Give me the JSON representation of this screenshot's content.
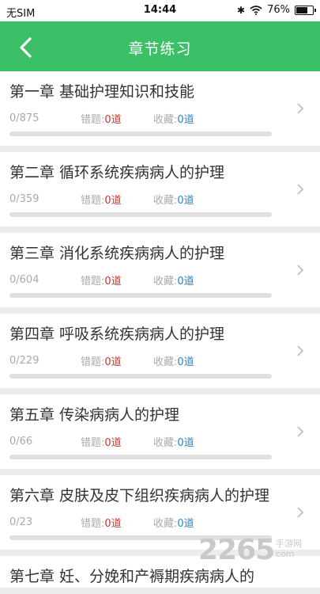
{
  "status_bar": {
    "carrier": "无SIM",
    "time": "14:44",
    "bluetooth": "✱",
    "battery_percent": "76%",
    "battery_level": 0.76
  },
  "header": {
    "title": "章节练习",
    "back_icon": "chevron-left-icon"
  },
  "colors": {
    "accent": "#3bbf67",
    "wrong": "#c0392b",
    "favorite": "#2e86c1"
  },
  "labels": {
    "wrong": "错题:",
    "favorite": "收藏:"
  },
  "chapters": [
    {
      "name": "第一章 基础护理知识和技能",
      "progress": "0/875",
      "wrong": "0道",
      "favorite": "0道",
      "fraction": 0
    },
    {
      "name": "第二章 循环系统疾病病人的护理",
      "progress": "0/359",
      "wrong": "0道",
      "favorite": "0道",
      "fraction": 0
    },
    {
      "name": "第三章 消化系统疾病病人的护理",
      "progress": "0/604",
      "wrong": "0道",
      "favorite": "0道",
      "fraction": 0
    },
    {
      "name": "第四章 呼吸系统疾病病人的护理",
      "progress": "0/229",
      "wrong": "0道",
      "favorite": "0道",
      "fraction": 0
    },
    {
      "name": "第五章 传染病病人的护理",
      "progress": "0/66",
      "wrong": "0道",
      "favorite": "0道",
      "fraction": 0
    },
    {
      "name": "第六章 皮肤及皮下组织疾病病人的护理",
      "progress": "0/23",
      "wrong": "0道",
      "favorite": "0道",
      "fraction": 0
    },
    {
      "name": "第七章 妊、分娩和产褥期疾病病人的",
      "progress": "",
      "wrong": "",
      "favorite": "",
      "fraction": 0
    }
  ],
  "watermark": {
    "brand": "2265",
    "line1": "手游网",
    "line2": "com"
  }
}
